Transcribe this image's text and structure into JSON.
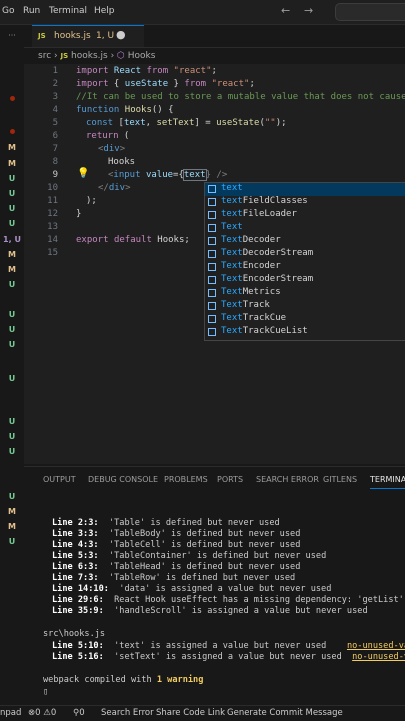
{
  "menu": [
    "Go",
    "Run",
    "Terminal",
    "Help"
  ],
  "tab": {
    "icon": "JS",
    "filename": "hooks.js",
    "status": "1, U"
  },
  "breadcrumb": {
    "folder": "src",
    "icon": "JS",
    "file": "hooks.js",
    "symbol": "Hooks"
  },
  "left_status": [
    "M",
    "M",
    "U",
    "U",
    "U",
    "U",
    "1, U",
    "M",
    "M",
    "U",
    "U",
    "U",
    "U",
    "U",
    "U",
    "U",
    "U",
    "U",
    "M",
    "M",
    "U"
  ],
  "lines": [
    {
      "n": "1"
    },
    {
      "n": "2"
    },
    {
      "n": "3"
    },
    {
      "n": "4"
    },
    {
      "n": "5"
    },
    {
      "n": "6"
    },
    {
      "n": "7"
    },
    {
      "n": "8"
    },
    {
      "n": "9"
    },
    {
      "n": "10"
    },
    {
      "n": "11"
    },
    {
      "n": "12"
    },
    {
      "n": "13"
    },
    {
      "n": "14"
    },
    {
      "n": "15"
    }
  ],
  "code": {
    "l1": [
      "import",
      " React ",
      "from",
      " \"react\"",
      ";"
    ],
    "l2": [
      "import",
      " { ",
      "useState",
      " } ",
      "from",
      " \"react\"",
      ";"
    ],
    "l3": "//It can be used to store a mutable value that does not cause",
    "l4": [
      "function",
      " ",
      "Hooks",
      "() {"
    ],
    "l5": [
      "const",
      " [",
      "text",
      ", ",
      "setText",
      "] = ",
      "useState",
      "(",
      "\"\"",
      ");"
    ],
    "l6": [
      "return",
      " ("
    ],
    "l7": [
      "<",
      "div",
      ">"
    ],
    "l8": "Hooks",
    "l9": [
      "<",
      "input",
      " ",
      "value",
      "={",
      "text",
      "} />"
    ],
    "l10": [
      "</",
      "div",
      ">"
    ],
    "l11": ");",
    "l12": "}",
    "l14": [
      "export",
      " ",
      "default",
      " Hooks;"
    ]
  },
  "suggestions": [
    {
      "match": "text",
      "rest": ""
    },
    {
      "match": "text",
      "rest": "FieldClasses"
    },
    {
      "match": "text",
      "rest": "FileLoader"
    },
    {
      "match": "Text",
      "rest": ""
    },
    {
      "match": "Text",
      "rest": "Decoder"
    },
    {
      "match": "Text",
      "rest": "DecoderStream"
    },
    {
      "match": "Text",
      "rest": "Encoder"
    },
    {
      "match": "Text",
      "rest": "EncoderStream"
    },
    {
      "match": "Text",
      "rest": "Metrics"
    },
    {
      "match": "Text",
      "rest": "Track"
    },
    {
      "match": "Text",
      "rest": "TrackCue"
    },
    {
      "match": "Text",
      "rest": "TrackCueList"
    }
  ],
  "panel_tabs": [
    "OUTPUT",
    "DEBUG CONSOLE",
    "PROBLEMS",
    "PORTS",
    "SEARCH ERROR",
    "GITLENS",
    "TERMINAL"
  ],
  "terminal": {
    "warnings1": [
      {
        "loc": "Line 2:3:",
        "msg": "'Table' is defined but never used"
      },
      {
        "loc": "Line 3:3:",
        "msg": "'TableBody' is defined but never used"
      },
      {
        "loc": "Line 4:3:",
        "msg": "'TableCell' is defined but never used"
      },
      {
        "loc": "Line 5:3:",
        "msg": "'TableContainer' is defined but never used"
      },
      {
        "loc": "Line 6:3:",
        "msg": "'TableHead' is defined but never used"
      },
      {
        "loc": "Line 7:3:",
        "msg": "'TableRow' is defined but never used"
      },
      {
        "loc": "Line 14:10:",
        "msg": "'data' is assigned a value but never used"
      },
      {
        "loc": "Line 29:6:",
        "msg": "React Hook useEffect has a missing dependency: 'getList'. Ei"
      },
      {
        "loc": "Line 35:9:",
        "msg": "'handleScroll' is assigned a value but never used"
      }
    ],
    "file": "src\\hooks.js",
    "warnings2": [
      {
        "loc": "Line 5:10:",
        "msg": "'text' is assigned a value but never used",
        "rule": "no-unused-vars"
      },
      {
        "loc": "Line 5:16:",
        "msg": "'setText' is assigned a value but never used",
        "rule": "no-unused-vars"
      }
    ],
    "compiled_prefix": "webpack compiled with ",
    "compiled_bold": "1 warning",
    "prompt": "▯"
  },
  "statusbar": {
    "left": "npad",
    "errors": "0",
    "warnings": "0",
    "ports": "0",
    "search_error": "Search Error",
    "share_code_link": "Share Code Link",
    "generate_commit": "Generate Commit Message"
  }
}
